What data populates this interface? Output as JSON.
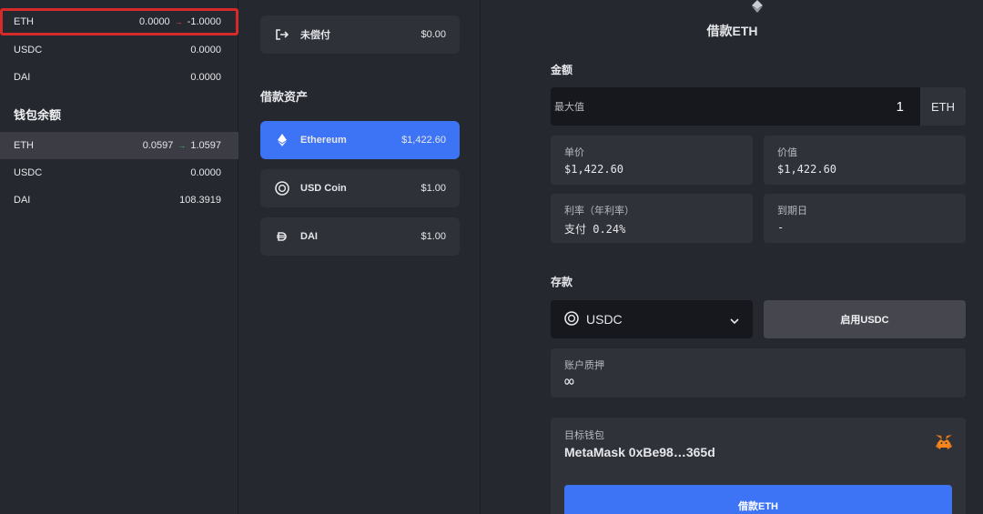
{
  "left": {
    "owed_rows": [
      {
        "asset": "ETH",
        "value": "0.0000",
        "arrow": "→",
        "new_value": "-1.0000"
      },
      {
        "asset": "USDC",
        "value": "0.0000"
      },
      {
        "asset": "DAI",
        "value": "0.0000"
      }
    ],
    "wallet_title": "钱包余额",
    "wallet_rows": [
      {
        "asset": "ETH",
        "value": "0.0597",
        "arrow": "→",
        "new_value": "1.0597"
      },
      {
        "asset": "USDC",
        "value": "0.0000"
      },
      {
        "asset": "DAI",
        "value": "108.3919"
      }
    ]
  },
  "middle": {
    "unpaid": {
      "label": "未偿付",
      "value": "$0.00",
      "icon": "exit-icon"
    },
    "borrow_assets_title": "借款资产",
    "assets": [
      {
        "name": "Ethereum",
        "price": "$1,422.60",
        "icon": "ethereum-icon",
        "selected": true
      },
      {
        "name": "USD Coin",
        "price": "$1.00",
        "icon": "usdc-icon",
        "selected": false
      },
      {
        "name": "DAI",
        "price": "$1.00",
        "icon": "dai-icon",
        "selected": false
      }
    ]
  },
  "right": {
    "heading": "借款ETH",
    "amount_label": "金额",
    "max_label": "最大值",
    "amount_value": "1",
    "amount_unit": "ETH",
    "price_label": "单价",
    "price_value": "$1,422.60",
    "worth_label": "价值",
    "worth_value": "$1,422.60",
    "rate_label": "利率（年利率）",
    "rate_value": "支付 0.24%",
    "maturity_label": "到期日",
    "maturity_value": "-",
    "deposit_label": "存款",
    "deposit_asset": "USDC",
    "enable_button": "启用USDC",
    "collateral_label": "账户质押",
    "collateral_value": "∞",
    "wallet_label": "目标钱包",
    "wallet_value": "MetaMask 0xBe98…365d",
    "borrow_button": "借款ETH"
  },
  "colors": {
    "accent": "#3d73f5",
    "danger": "#e24b4b",
    "success": "#38c172",
    "highlight_border": "#d42a2a"
  }
}
